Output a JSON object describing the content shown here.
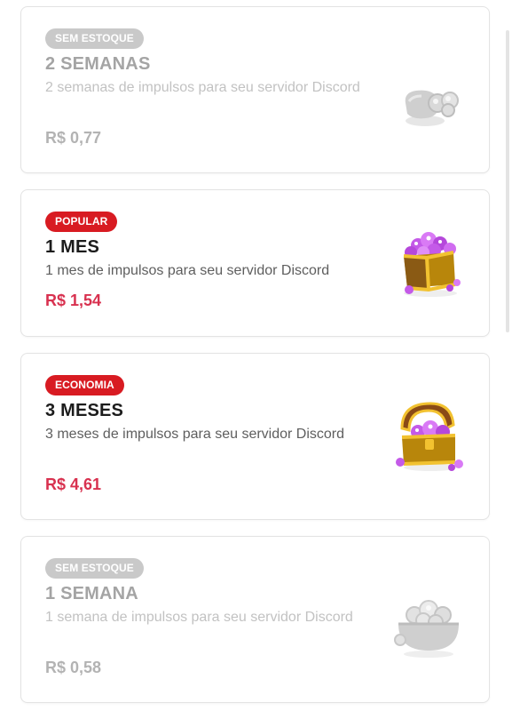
{
  "plans": [
    {
      "badge": "SEM ESTOQUE",
      "title": "2 SEMANAS",
      "description": "2 semanas de impulsos para seu servidor Discord",
      "price": "R$ 0,77",
      "status": "out-of-stock",
      "icon": "gem-pouch-icon"
    },
    {
      "badge": "POPULAR",
      "title": "1 MES",
      "description": "1 mes de impulsos para seu servidor Discord",
      "price": "R$ 1,54",
      "status": "available",
      "icon": "gem-crate-icon"
    },
    {
      "badge": "ECONOMIA",
      "title": "3 MESES",
      "description": "3 meses de impulsos para seu servidor Discord",
      "price": "R$ 4,61",
      "status": "available",
      "icon": "treasure-chest-icon"
    },
    {
      "badge": "SEM ESTOQUE",
      "title": "1 SEMANA",
      "description": "1 semana de impulsos para seu servidor Discord",
      "price": "R$ 0,58",
      "status": "out-of-stock",
      "icon": "gem-bowl-icon"
    }
  ],
  "colors": {
    "badge_red": "#d81b22",
    "badge_gray": "#c9c9c9",
    "price_accent": "#d8314f",
    "gem_purple": "#c45ae8",
    "gold": "#e8a317"
  }
}
